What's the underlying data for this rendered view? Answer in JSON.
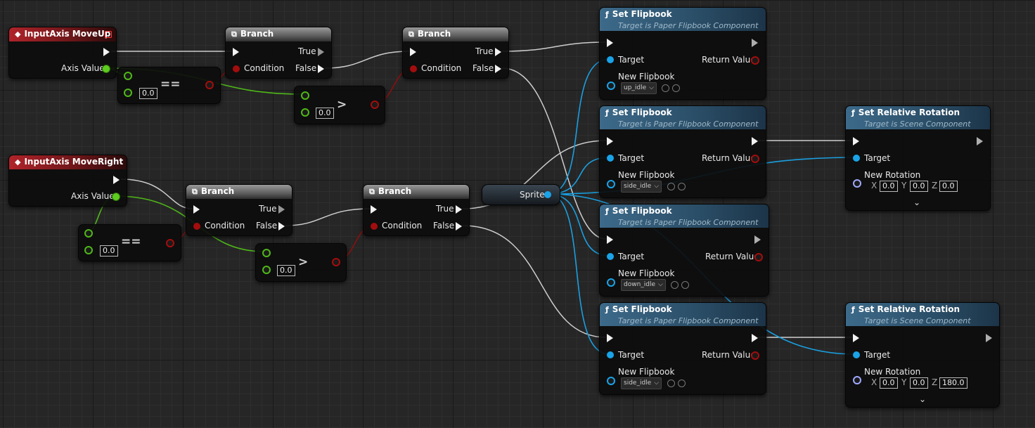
{
  "moveup": {
    "title": "InputAxis MoveUp",
    "axis_value": "Axis Value"
  },
  "moveright": {
    "title": "InputAxis MoveRight",
    "axis_value": "Axis Value"
  },
  "branch": {
    "title": "Branch",
    "true_label": "True",
    "false_label": "False",
    "condition_label": "Condition"
  },
  "compare": {
    "equals": "==",
    "greater": ">",
    "default_value": "0.0"
  },
  "sprite": {
    "label": "Sprite"
  },
  "set_flipbook": {
    "title": "Set Flipbook",
    "subtitle": "Target is Paper Flipbook Component",
    "target_label": "Target",
    "return_label": "Return Value",
    "new_flipbook_label": "New Flipbook",
    "options": [
      "up_idle",
      "side_idle",
      "down_idle",
      "side_idle"
    ]
  },
  "set_rotation": {
    "title": "Set Relative Rotation",
    "subtitle": "Target is Scene Component",
    "target_label": "Target",
    "new_rotation_label": "New Rotation",
    "axis_x": "X",
    "axis_y": "Y",
    "axis_z": "Z",
    "node1": {
      "x": "0.0",
      "y": "0.0",
      "z": "0.0"
    },
    "node2": {
      "x": "0.0",
      "y": "0.0",
      "z": "180.0"
    }
  },
  "icons": {
    "event": "event-diamond-icon",
    "branch": "branch-icon",
    "function": "function-icon"
  },
  "colors": {
    "exec": "#f2f2f2",
    "float": "#5dcc1f",
    "bool": "#a30d0d",
    "object": "#1aa3e8",
    "rotator": "#a0a8ff"
  }
}
